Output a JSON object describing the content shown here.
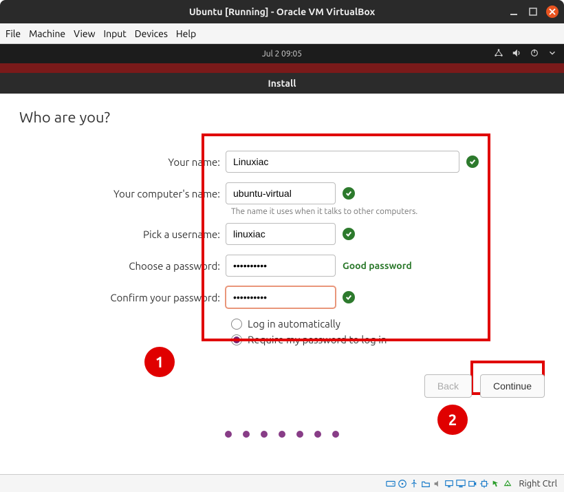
{
  "window": {
    "title": "Ubuntu [Running] - Oracle VM VirtualBox"
  },
  "menubar": {
    "items": [
      "File",
      "Machine",
      "View",
      "Input",
      "Devices",
      "Help"
    ]
  },
  "guest": {
    "clock": "Jul 2  09:05",
    "install_title": "Install",
    "page_title": "Who are you?"
  },
  "form": {
    "name": {
      "label": "Your name:",
      "value": "Linuxiac"
    },
    "computer": {
      "label": "Your computer's name:",
      "value": "ubuntu-virtual",
      "hint": "The name it uses when it talks to other computers."
    },
    "username": {
      "label": "Pick a username:",
      "value": "linuxiac"
    },
    "password": {
      "label": "Choose a password:",
      "value": "••••••••••",
      "strength": "Good password"
    },
    "confirm": {
      "label": "Confirm your password:",
      "value": "••••••••••"
    },
    "auto_login": {
      "label": "Log in automatically"
    },
    "require_pw": {
      "label": "Require my password to log in"
    }
  },
  "buttons": {
    "back": "Back",
    "continue": "Continue"
  },
  "statusbar": {
    "key": "Right Ctrl"
  },
  "annotations": {
    "one": "1",
    "two": "2"
  }
}
